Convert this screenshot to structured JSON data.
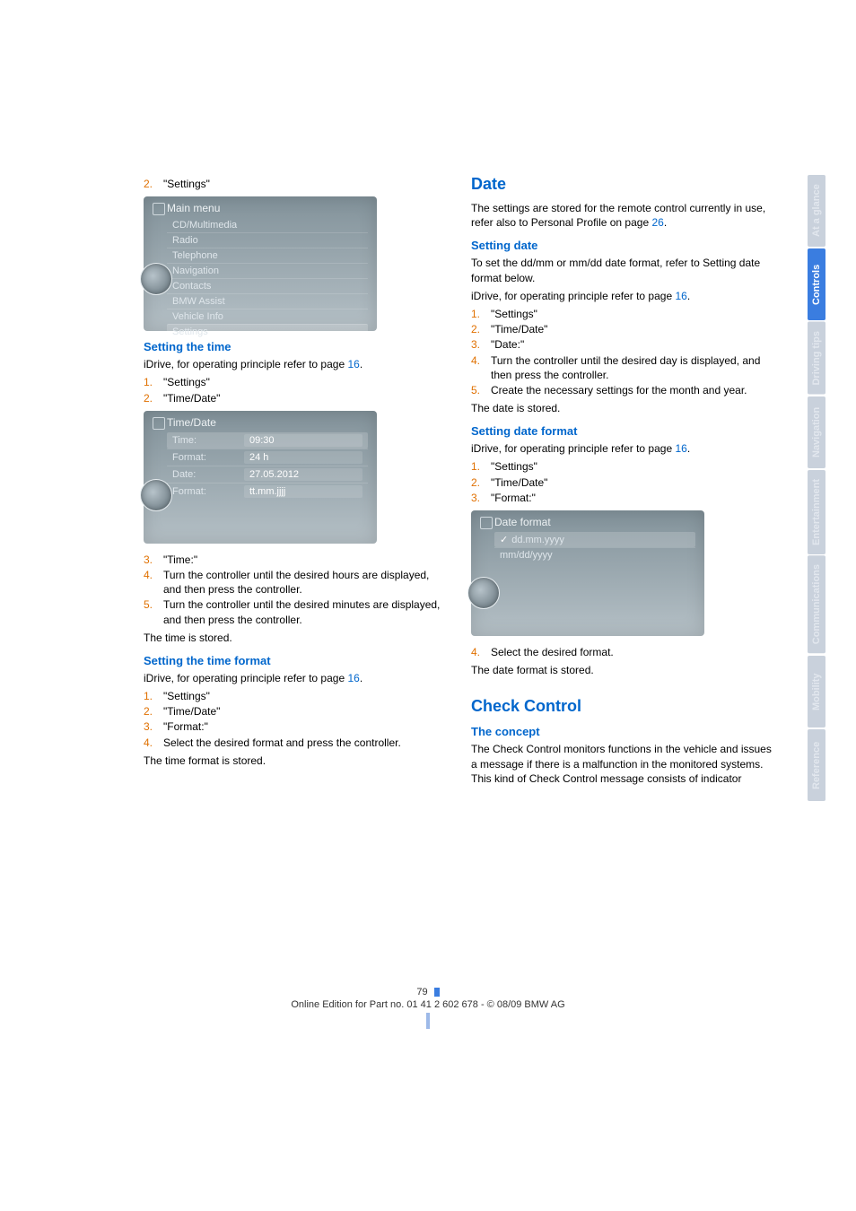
{
  "left": {
    "step_start": {
      "num": "2.",
      "text": "\"Settings\""
    },
    "ss1": {
      "title": "Main menu",
      "items": [
        "CD/Multimedia",
        "Radio",
        "Telephone",
        "Navigation",
        "Contacts",
        "BMW Assist",
        "Vehicle Info",
        "Settings"
      ],
      "hl_index": 7
    },
    "h1": "Setting the time",
    "intro1a": "iDrive, for operating principle refer to page ",
    "intro1_pg": "16",
    "intro1b": ".",
    "list1": [
      {
        "n": "1.",
        "t": "\"Settings\""
      },
      {
        "n": "2.",
        "t": "\"Time/Date\""
      }
    ],
    "ss2": {
      "title": "Time/Date",
      "rows": [
        {
          "lbl": "Time:",
          "val": "09:30",
          "hl": true
        },
        {
          "lbl": "Format:",
          "val": "24 h"
        },
        {
          "lbl": "Date:",
          "val": "27.05.2012"
        },
        {
          "lbl": "Format:",
          "val": "tt.mm.jjjj"
        }
      ]
    },
    "list2": [
      {
        "n": "3.",
        "t": "\"Time:\""
      },
      {
        "n": "4.",
        "t": "Turn the controller until the desired hours are displayed, and then press the controller."
      },
      {
        "n": "5.",
        "t": "Turn the controller until the desired minutes are displayed, and then press the controller."
      }
    ],
    "after2": "The time is stored.",
    "h2": "Setting the time format",
    "intro2a": "iDrive, for operating principle refer to page ",
    "intro2_pg": "16",
    "intro2b": ".",
    "list3": [
      {
        "n": "1.",
        "t": "\"Settings\""
      },
      {
        "n": "2.",
        "t": "\"Time/Date\""
      },
      {
        "n": "3.",
        "t": "\"Format:\""
      },
      {
        "n": "4.",
        "t": "Select the desired format and press the controller."
      }
    ],
    "after3": "The time format is stored."
  },
  "right": {
    "h_main": "Date",
    "intro_a": "The settings are stored for the remote control currently in use, refer also to Personal Profile on page ",
    "intro_pg": "26",
    "intro_b": ".",
    "h_sd": "Setting date",
    "sd_p1": "To set the dd/mm or mm/dd date format, refer to Setting date format below.",
    "sd_p2a": "iDrive, for operating principle refer to page ",
    "sd_p2_pg": "16",
    "sd_p2b": ".",
    "sd_list": [
      {
        "n": "1.",
        "t": "\"Settings\""
      },
      {
        "n": "2.",
        "t": "\"Time/Date\""
      },
      {
        "n": "3.",
        "t": "\"Date:\""
      },
      {
        "n": "4.",
        "t": "Turn the controller until the desired day is displayed, and then press the controller."
      },
      {
        "n": "5.",
        "t": "Create the necessary settings for the month and year."
      }
    ],
    "sd_after": "The date is stored.",
    "h_sdf": "Setting date format",
    "sdf_p1a": "iDrive, for operating principle refer to page ",
    "sdf_p1_pg": "16",
    "sdf_p1b": ".",
    "sdf_list": [
      {
        "n": "1.",
        "t": "\"Settings\""
      },
      {
        "n": "2.",
        "t": "\"Time/Date\""
      },
      {
        "n": "3.",
        "t": "\"Format:\""
      }
    ],
    "ss3": {
      "title": "Date format",
      "rows": [
        {
          "lbl": "dd.mm.yyyy",
          "check": true,
          "hl": true
        },
        {
          "lbl": "mm/dd/yyyy"
        }
      ]
    },
    "sdf_list2": [
      {
        "n": "4.",
        "t": "Select the desired format."
      }
    ],
    "sdf_after": "The date format is stored.",
    "h_cc": "Check Control",
    "h_concept": "The concept",
    "cc_body": "The Check Control monitors functions in the vehicle and issues a message if there is a malfunction in the monitored systems. This kind of Check Control message consists of indicator"
  },
  "tabs": [
    "At a glance",
    "Controls",
    "Driving tips",
    "Navigation",
    "Entertainment",
    "Communications",
    "Mobility",
    "Reference"
  ],
  "tab_active_index": 1,
  "footer": {
    "page_num": "79",
    "edition": "Online Edition for Part no. 01 41 2 602 678 - © 08/09 BMW AG"
  }
}
